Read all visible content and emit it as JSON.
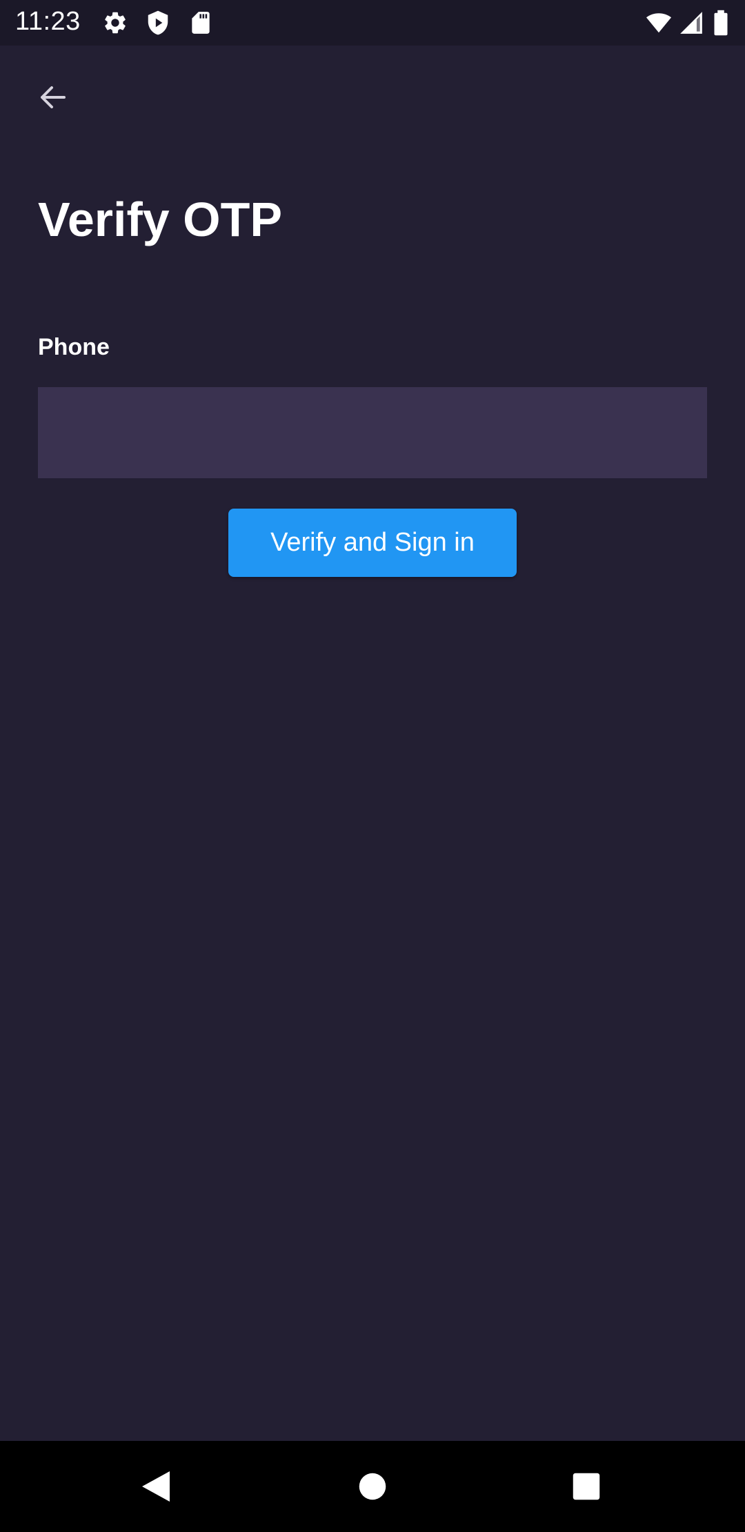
{
  "status_bar": {
    "time": "11:23",
    "left_icons": [
      "gear-icon",
      "shield-icon",
      "sd-card-icon"
    ],
    "right_icons": [
      "wifi-icon",
      "signal-icon",
      "battery-icon"
    ]
  },
  "header": {
    "back_icon": "arrow-left-icon"
  },
  "main": {
    "title": "Verify OTP",
    "phone_label": "Phone",
    "phone_value": "",
    "verify_button_label": "Verify and Sign in"
  },
  "nav_bar": {
    "buttons": [
      "back-triangle-icon",
      "home-circle-icon",
      "recents-square-icon"
    ]
  },
  "colors": {
    "background": "#231f33",
    "status_bar": "#1b1828",
    "input_background": "#3a3250",
    "accent": "#2196f3",
    "nav_bar": "#000000"
  }
}
